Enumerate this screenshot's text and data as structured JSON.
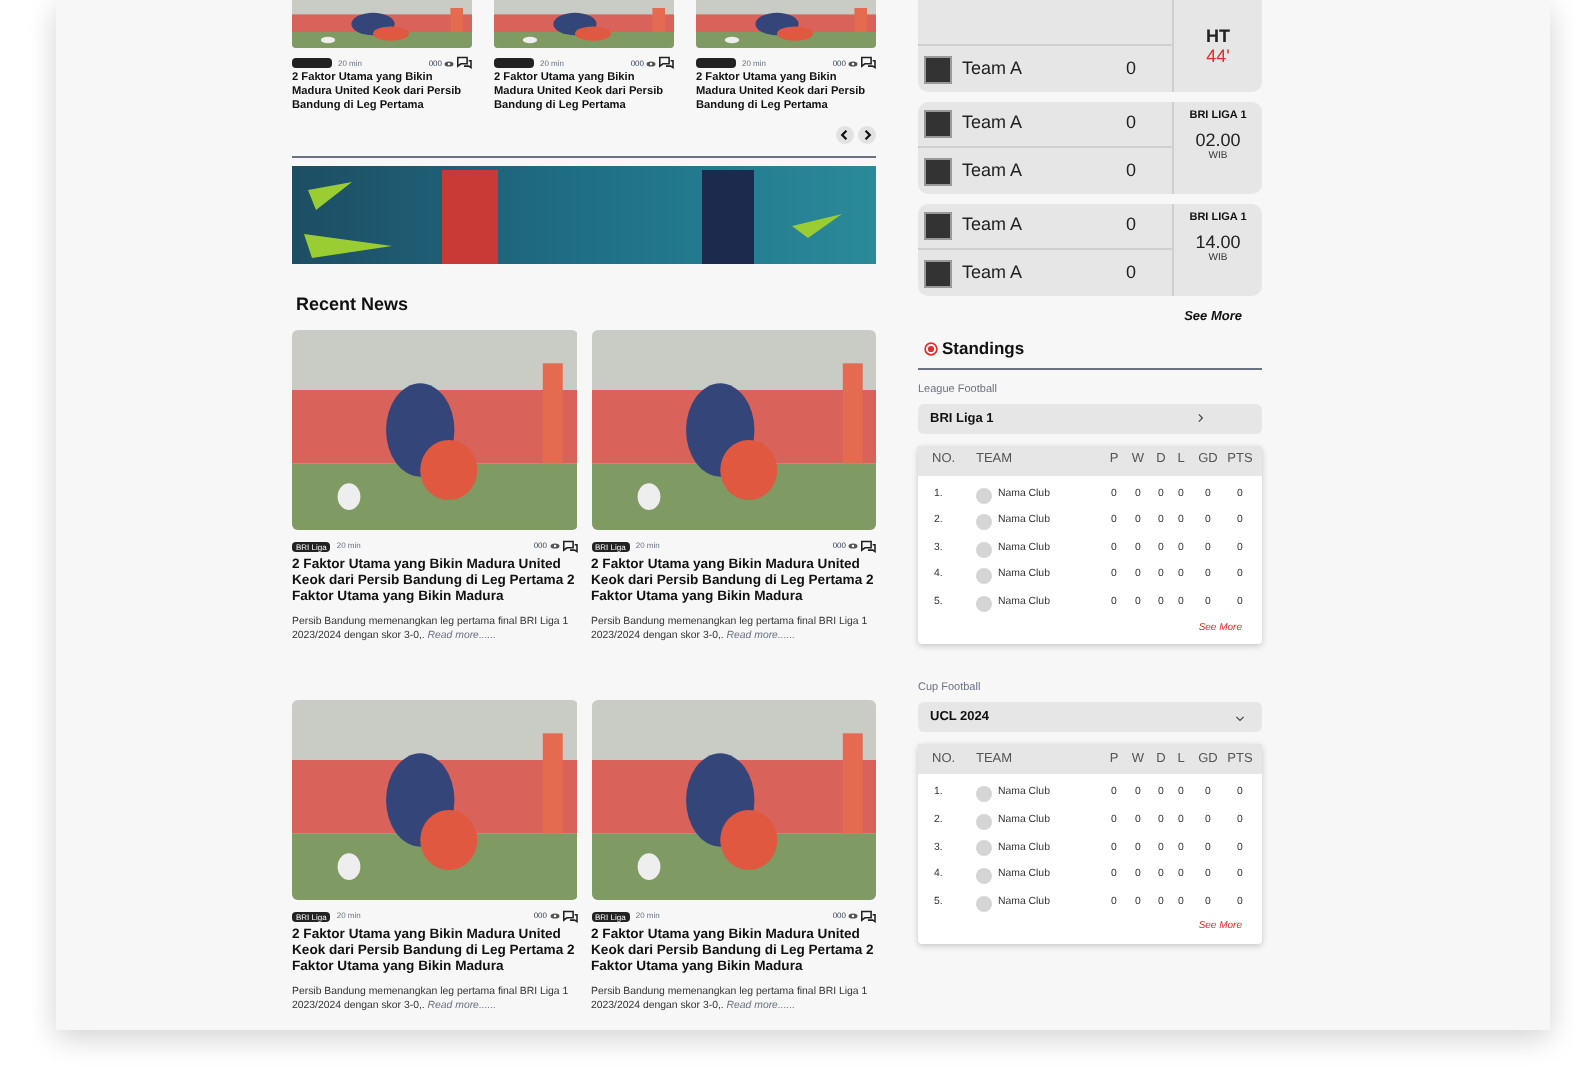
{
  "top_cards": [
    {
      "time": "20 min",
      "comments": "000",
      "title": "2 Faktor Utama yang Bikin Madura United Keok dari Persib Bandung di Leg Pertama"
    },
    {
      "time": "20 min",
      "comments": "000",
      "title": "2 Faktor Utama yang Bikin Madura United Keok dari Persib Bandung di Leg Pertama"
    },
    {
      "time": "20 min",
      "comments": "000",
      "title": "2 Faktor Utama yang Bikin Madura United Keok dari Persib Bandung di Leg Pertama"
    }
  ],
  "recent_news": {
    "title": "Recent News",
    "articles": [
      {
        "tag": "BRI Liga",
        "time": "20 min",
        "comments": "000",
        "title": "2 Faktor Utama yang Bikin Madura United Keok dari Persib Bandung di Leg Pertama 2 Faktor Utama yang Bikin Madura",
        "excerpt": "Persib Bandung memenangkan leg pertama final BRI Liga 1 2023/2024 dengan skor 3-0,.",
        "read_more": "Read more......"
      },
      {
        "tag": "BRI Liga",
        "time": "20 min",
        "comments": "000",
        "title": "2 Faktor Utama yang Bikin Madura United Keok dari Persib Bandung di Leg Pertama 2 Faktor Utama yang Bikin Madura",
        "excerpt": "Persib Bandung memenangkan leg pertama final BRI Liga 1 2023/2024 dengan skor 3-0,.",
        "read_more": "Read more......"
      },
      {
        "tag": "BRI Liga",
        "time": "20 min",
        "comments": "000",
        "title": "2 Faktor Utama yang Bikin Madura United Keok dari Persib Bandung di Leg Pertama 2 Faktor Utama yang Bikin Madura",
        "excerpt": "Persib Bandung memenangkan leg pertama final BRI Liga 1 2023/2024 dengan skor 3-0,.",
        "read_more": "Read more......"
      },
      {
        "tag": "BRI Liga",
        "time": "20 min",
        "comments": "000",
        "title": "2 Faktor Utama yang Bikin Madura United Keok dari Persib Bandung di Leg Pertama 2 Faktor Utama yang Bikin Madura",
        "excerpt": "Persib Bandung memenangkan leg pertama final BRI Liga 1 2023/2024 dengan skor 3-0,.",
        "read_more": "Read more......"
      }
    ]
  },
  "matches": [
    {
      "kind": "live",
      "status": "HT",
      "minute": "44'",
      "rows": [
        {
          "team": "Team A",
          "score": "0"
        }
      ]
    },
    {
      "kind": "scheduled",
      "league": "BRI LIGA 1",
      "time": "02.00",
      "zone": "WIB",
      "rows": [
        {
          "team": "Team A",
          "score": "0"
        },
        {
          "team": "Team A",
          "score": "0"
        }
      ]
    },
    {
      "kind": "scheduled",
      "league": "BRI LIGA 1",
      "time": "14.00",
      "zone": "WIB",
      "rows": [
        {
          "team": "Team A",
          "score": "0"
        },
        {
          "team": "Team A",
          "score": "0"
        }
      ]
    }
  ],
  "matches_see_more": "See More",
  "standings": {
    "title": "Standings",
    "groups": [
      {
        "label": "League Football",
        "selector": "BRI Liga 1",
        "kind": "link",
        "columns": [
          "NO.",
          "TEAM",
          "P",
          "W",
          "D",
          "L",
          "GD",
          "PTS"
        ],
        "rows": [
          [
            "1.",
            "Nama Club",
            "0",
            "0",
            "0",
            "0",
            "0",
            "0"
          ],
          [
            "2.",
            "Nama Club",
            "0",
            "0",
            "0",
            "0",
            "0",
            "0"
          ],
          [
            "3.",
            "Nama Club",
            "0",
            "0",
            "0",
            "0",
            "0",
            "0"
          ],
          [
            "4.",
            "Nama Club",
            "0",
            "0",
            "0",
            "0",
            "0",
            "0"
          ],
          [
            "5.",
            "Nama Club",
            "0",
            "0",
            "0",
            "0",
            "0",
            "0"
          ]
        ],
        "see_more": "See More"
      },
      {
        "label": "Cup Football",
        "selector": "UCL 2024",
        "kind": "dropdown",
        "columns": [
          "NO.",
          "TEAM",
          "P",
          "W",
          "D",
          "L",
          "GD",
          "PTS"
        ],
        "rows": [
          [
            "1.",
            "Nama Club",
            "0",
            "0",
            "0",
            "0",
            "0",
            "0"
          ],
          [
            "2.",
            "Nama Club",
            "0",
            "0",
            "0",
            "0",
            "0",
            "0"
          ],
          [
            "3.",
            "Nama Club",
            "0",
            "0",
            "0",
            "0",
            "0",
            "0"
          ],
          [
            "4.",
            "Nama Club",
            "0",
            "0",
            "0",
            "0",
            "0",
            "0"
          ],
          [
            "5.",
            "Nama Club",
            "0",
            "0",
            "0",
            "0",
            "0",
            "0"
          ]
        ],
        "see_more": "See More"
      }
    ]
  }
}
